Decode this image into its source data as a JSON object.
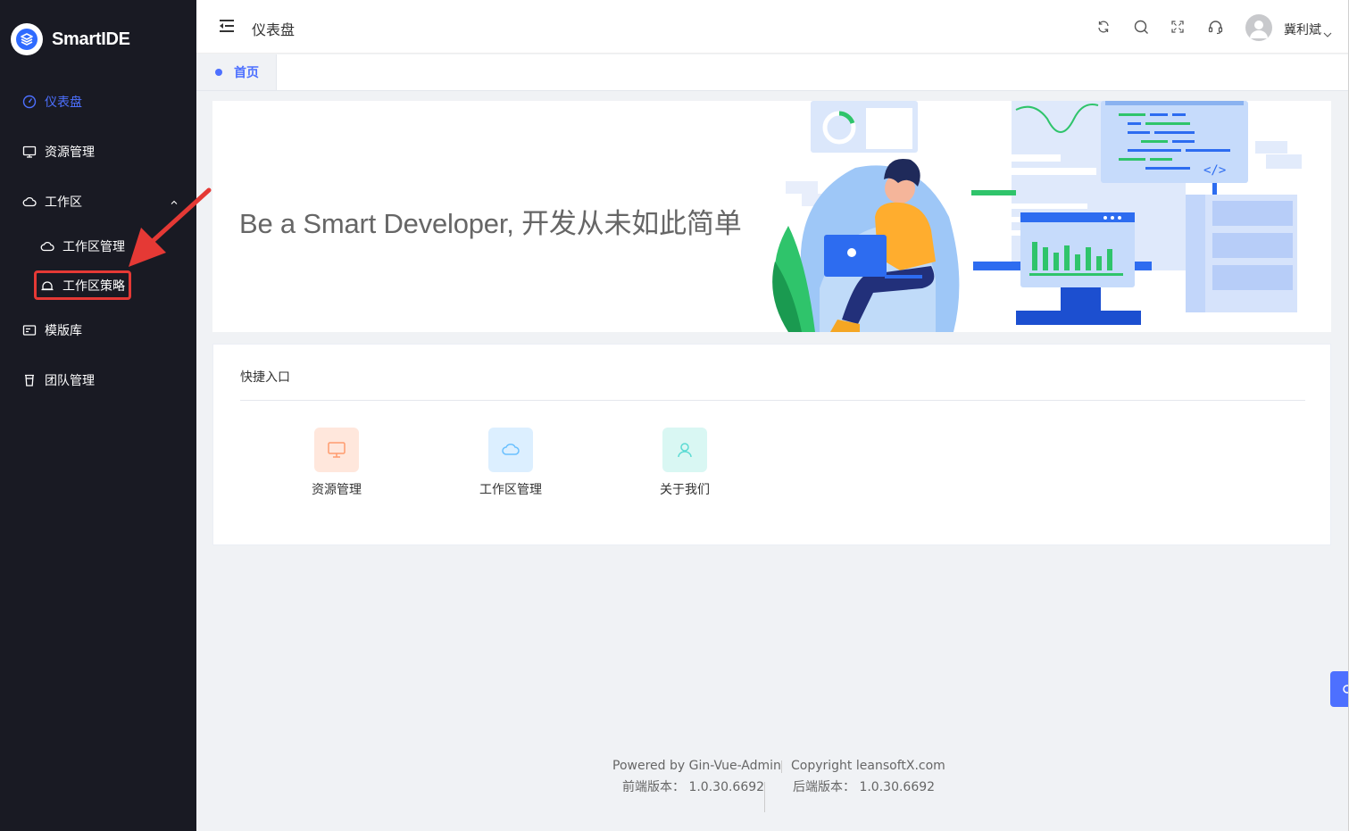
{
  "app": {
    "name": "SmartIDE"
  },
  "sidebar": {
    "items": [
      {
        "label": "仪表盘",
        "icon": "dashboard-icon",
        "active": true
      },
      {
        "label": "资源管理",
        "icon": "monitor-icon"
      },
      {
        "label": "工作区",
        "icon": "cloud-icon",
        "expanded": true,
        "children": [
          {
            "label": "工作区管理",
            "icon": "cloud-icon"
          },
          {
            "label": "工作区策略",
            "icon": "bell-icon"
          }
        ]
      },
      {
        "label": "模版库",
        "icon": "template-icon"
      },
      {
        "label": "团队管理",
        "icon": "cup-icon"
      }
    ]
  },
  "header": {
    "title": "仪表盘",
    "icons": [
      "refresh-icon",
      "search-icon",
      "fullscreen-icon",
      "headset-icon"
    ],
    "user": {
      "name": "冀利斌"
    }
  },
  "tabs": [
    {
      "label": "首页",
      "active": true
    }
  ],
  "banner": {
    "text": "Be a Smart Developer, 开发从未如此简单"
  },
  "quick": {
    "title": "快捷入口",
    "items": [
      {
        "label": "资源管理",
        "icon": "monitor-icon",
        "color": "#ff9c6e",
        "bg": "#ffe7dc"
      },
      {
        "label": "工作区管理",
        "icon": "cloud-icon",
        "color": "#69c0ff",
        "bg": "#dcefff"
      },
      {
        "label": "关于我们",
        "icon": "user-icon",
        "color": "#5cdbd3",
        "bg": "#d9f7f3"
      }
    ]
  },
  "footer": {
    "powered_label": "Powered by",
    "powered_value": "Gin-Vue-Admin",
    "copyright_label": "Copyright",
    "copyright_value": "leansoftX.com",
    "frontend_label": "前端版本：",
    "frontend_value": "1.0.30.6692",
    "backend_label": "后端版本：",
    "backend_value": "1.0.30.6692"
  },
  "colors": {
    "accent": "#4d70ff",
    "sidebar_bg": "#191a23",
    "highlight": "#e53935"
  }
}
